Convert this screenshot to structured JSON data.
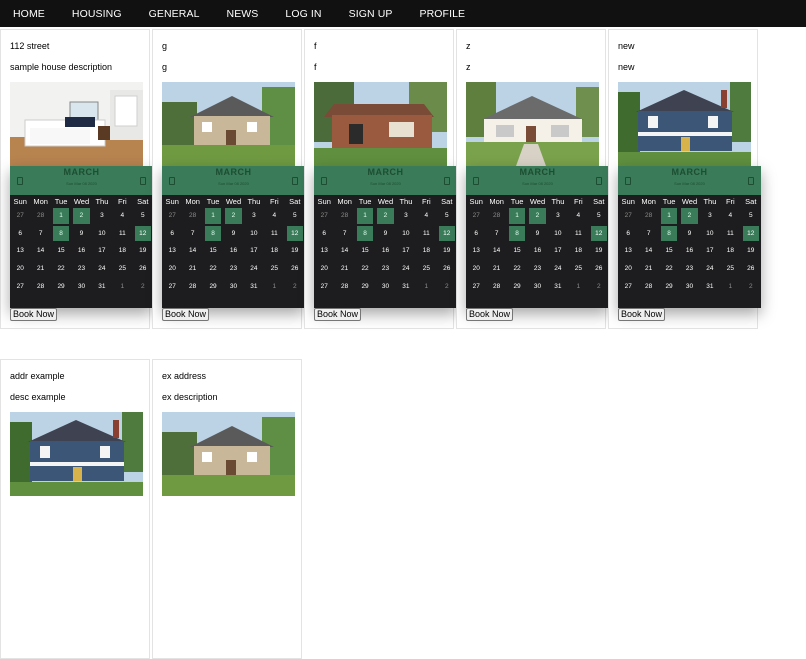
{
  "nav": {
    "items": [
      "HOME",
      "HOUSING",
      "GENERAL",
      "NEWS",
      "LOG IN",
      "SIGN UP",
      "PROFILE"
    ]
  },
  "calendar": {
    "month": "MARCH",
    "date_line": "Sun Mar 08 2020",
    "weekdays": [
      "Sun",
      "Mon",
      "Tue",
      "Wed",
      "Thu",
      "Fri",
      "Sat"
    ],
    "days": [
      {
        "d": "27",
        "o": true
      },
      {
        "d": "28",
        "o": true
      },
      {
        "d": "1",
        "s": true
      },
      {
        "d": "2",
        "s": true
      },
      {
        "d": "3"
      },
      {
        "d": "4"
      },
      {
        "d": "5"
      },
      {
        "d": "6"
      },
      {
        "d": "7"
      },
      {
        "d": "8",
        "s": true
      },
      {
        "d": "9"
      },
      {
        "d": "10"
      },
      {
        "d": "11"
      },
      {
        "d": "12"
      },
      {
        "d": "13"
      },
      {
        "d": "14"
      },
      {
        "d": "15"
      },
      {
        "d": "16"
      },
      {
        "d": "17"
      },
      {
        "d": "18"
      },
      {
        "d": "19"
      },
      {
        "d": "20"
      },
      {
        "d": "21"
      },
      {
        "d": "22"
      },
      {
        "d": "23"
      },
      {
        "d": "24"
      },
      {
        "d": "25"
      },
      {
        "d": "26"
      },
      {
        "d": "27"
      },
      {
        "d": "28"
      },
      {
        "d": "29"
      },
      {
        "d": "30"
      },
      {
        "d": "31"
      },
      {
        "d": "1",
        "o": true
      },
      {
        "d": "2",
        "o": true
      }
    ],
    "row_start_index": [
      0,
      7,
      14,
      21,
      28
    ],
    "today": "12"
  },
  "book_label": "Book Now",
  "listings": [
    {
      "address": "112 street",
      "description": "sample house description",
      "photo": "bedroom"
    },
    {
      "address": "g",
      "description": "g",
      "photo": "house-tan"
    },
    {
      "address": "f",
      "description": "f",
      "photo": "house-brick"
    },
    {
      "address": "z",
      "description": "z",
      "photo": "house-white"
    },
    {
      "address": "new",
      "description": "new",
      "photo": "house-blue"
    },
    {
      "address": "addr example",
      "description": "desc example",
      "photo": "house-blue"
    },
    {
      "address": "ex address",
      "description": "ex description",
      "photo": "house-tan"
    }
  ],
  "colors": {
    "nav_bg": "#111111",
    "calendar_header": "#3a7b59",
    "calendar_body": "#1d1d1f",
    "selected_day": "#3a7b59"
  }
}
